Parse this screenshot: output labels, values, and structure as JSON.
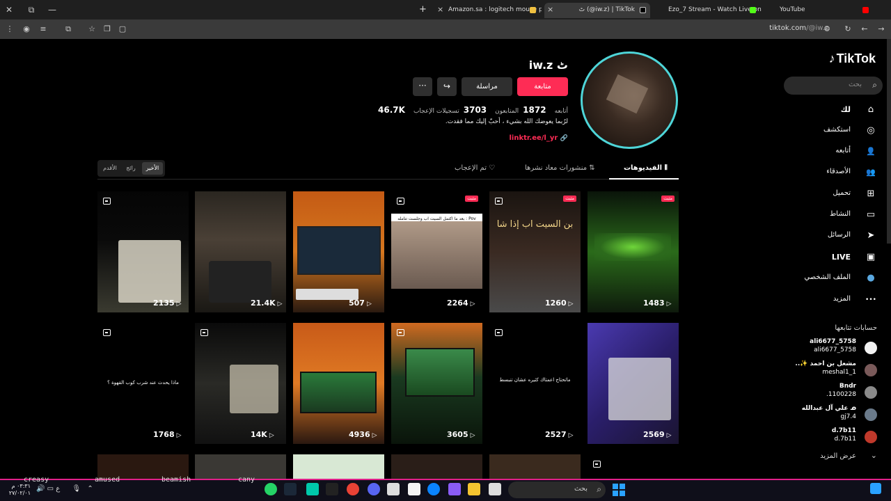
{
  "browser": {
    "tabs": [
      {
        "title": "Amazon.sa : logitech mouse pr",
        "active": false
      },
      {
        "title": "ٹ (@iw.z) | TikTok",
        "active": true
      },
      {
        "title": "Ezo_7 Stream - Watch Live on K",
        "active": false
      },
      {
        "title": "YouTube",
        "active": false
      }
    ],
    "url_host": "tiktok.com",
    "url_path": "/@iw.z",
    "new_tab": "+",
    "close": "×"
  },
  "tiktok": {
    "logo": "TikTok",
    "search_placeholder": "بحث",
    "nav": [
      {
        "label": "لك",
        "icon": "home-icon",
        "glyph": "⌂"
      },
      {
        "label": "استكشف",
        "icon": "compass-icon",
        "glyph": "◎"
      },
      {
        "label": "أتابعه",
        "icon": "following-icon",
        "glyph": "👤"
      },
      {
        "label": "الأصدقاء",
        "icon": "friends-icon",
        "glyph": "👥"
      },
      {
        "label": "تحميل",
        "icon": "upload-icon",
        "glyph": "⊞"
      },
      {
        "label": "النشاط",
        "icon": "activity-icon",
        "glyph": "▭"
      },
      {
        "label": "الرسائل",
        "icon": "messages-icon",
        "glyph": "➤"
      },
      {
        "label": "LIVE",
        "icon": "live-icon",
        "glyph": "▣"
      },
      {
        "label": "الملف الشخصي",
        "icon": "profile-avatar-icon",
        "glyph": "●"
      },
      {
        "label": "المزيد",
        "icon": "more-icon",
        "glyph": "•••"
      }
    ],
    "following_title": "حسابات تتابعها",
    "following": [
      {
        "name": "ali6677_5758",
        "handle": "ali6677_5758",
        "avatar_color": "#f2f2f2"
      },
      {
        "name": "مشعل بن احمد ✨..",
        "handle": "meshal1_1",
        "avatar_color": "#7a5a5a"
      },
      {
        "name": "Bndr",
        "handle": "1100228.",
        "avatar_color": "#8a8a8a"
      },
      {
        "name": "ᓄ علي آل عبدالله",
        "handle": "gj7.4",
        "avatar_color": "#6a7a8a"
      },
      {
        "name": "d.7b11",
        "handle": "d.7b11",
        "avatar_color": "#c0392b"
      }
    ],
    "see_more": "عرض المزيد"
  },
  "profile": {
    "username": "ٹ  iw.z",
    "follow": "متابعة",
    "message": "مراسلة",
    "share_glyph": "↪",
    "more_glyph": "···",
    "following_count": "1872",
    "following_label": "أتابعه",
    "followers_count": "3703",
    "followers_label": "المتابعون",
    "likes_count": "46.7K",
    "likes_label": "تسجيلات الإعجاب",
    "bio": "لرُبما يعوضك الله بشيء ، أحبّ إليك مما فقدت.",
    "link": "linktr.ee/l_yr"
  },
  "profile_tabs": {
    "videos": "الفيديوهات",
    "reposts": "منشورات معاد نشرها",
    "liked": "تم الإعجاب",
    "sort": [
      "الأخير",
      "رائج",
      "الأقدم"
    ]
  },
  "videos": [
    {
      "views": "1483",
      "pinned": "مثبت",
      "type": "video"
    },
    {
      "views": "1260",
      "pinned": "مثبت",
      "type": "photo",
      "caption": "بن السيت اب إذا شا"
    },
    {
      "views": "2264",
      "pinned": "مثبت",
      "type": "photo",
      "caption": "Pov : بعد ما اكتمل السيت اب وجلست تتأمله"
    },
    {
      "views": "507",
      "type": "video"
    },
    {
      "views": "21.4K",
      "type": "video"
    },
    {
      "views": "2135",
      "type": "photo"
    },
    {
      "views": "2569",
      "type": "video"
    },
    {
      "views": "2527",
      "type": "photo",
      "caption": "ماتحتاج اعمتاك كثيره عشان تنبسط"
    },
    {
      "views": "3605",
      "type": "photo"
    },
    {
      "views": "4936",
      "type": "video"
    },
    {
      "views": "14K",
      "type": "photo"
    },
    {
      "views": "1768",
      "type": "photo",
      "caption": "ماذا يحدث عند شرب كوب القهوة ؟"
    }
  ],
  "taskbar": {
    "stickers": [
      "creasy",
      "amused",
      "beamish",
      "cany"
    ],
    "search_placeholder": "بحث",
    "clock": "٠٣:٣١ م",
    "date": "٢٧/٠٢/٠١",
    "tray": "ع"
  }
}
